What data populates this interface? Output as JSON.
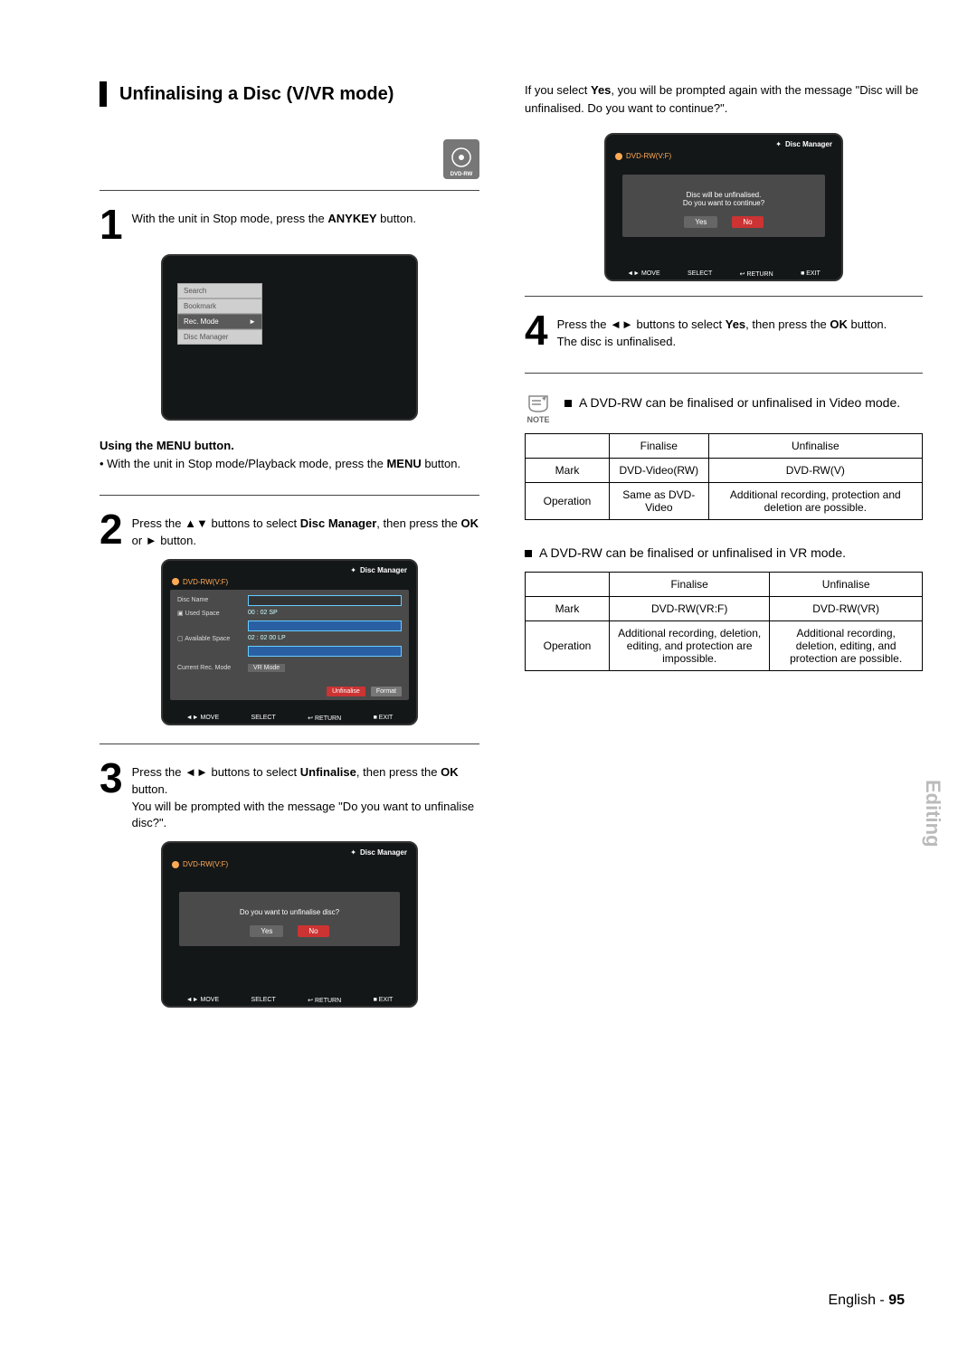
{
  "title": "Unfinalising a Disc (V/VR mode)",
  "disc_icon_label": "DVD-RW",
  "step1": {
    "num": "1",
    "text_a": "With the unit in Stop mode, press the ",
    "bold": "ANYKEY",
    "text_b": " button."
  },
  "anykey_menu": {
    "items": [
      "Search",
      "Bookmark",
      "Rec. Mode",
      "Disc Manager"
    ],
    "selected": "Rec. Mode",
    "arrow": "►"
  },
  "using_menu_head": "Using the MENU button.",
  "using_menu_text_a": "• With the unit in Stop mode/Playback mode, press the ",
  "using_menu_bold": "MENU",
  "using_menu_text_b": " button.",
  "step2": {
    "num": "2",
    "text_a": "Press the ▲▼ buttons to select ",
    "bold1": "Disc Manager",
    "text_b": ", then press the ",
    "bold2": "OK",
    "text_c": " or ► button."
  },
  "dm_screen": {
    "header": "Disc Manager",
    "sub": "DVD-RW(V:F)",
    "rows": {
      "disc_name": "Disc Name",
      "used_space": "Used Space",
      "used_val": "00 : 02  SP",
      "avail_space": "Available Space",
      "avail_val": "02 : 02  00 LP",
      "rec_mode_label": "Current Rec. Mode",
      "rec_mode_val": "VR Mode"
    },
    "btn_unfinalise": "Unfinalise",
    "btn_format": "Format",
    "foot": {
      "move": "◄► MOVE",
      "select": "SELECT",
      "return": "↩ RETURN",
      "exit": "■ EXIT"
    }
  },
  "step3": {
    "num": "3",
    "text_a": "Press the ◄► buttons to select ",
    "bold1": "Unfinalise",
    "text_b": ", then press the ",
    "bold2": "OK",
    "text_c": " button.",
    "line2": "You will be prompted with the message \"Do you want to unfinalise disc?\"."
  },
  "prompt1": {
    "msg": "Do you want to unfinalise disc?",
    "yes": "Yes",
    "no": "No"
  },
  "right_intro_a": "If you select ",
  "right_intro_bold": "Yes",
  "right_intro_b": ", you will be prompted again with the message \"Disc will be unfinalised. Do you want to continue?\".",
  "prompt2": {
    "line1": "Disc will be unfinalised.",
    "line2": "Do you want to continue?",
    "yes": "Yes",
    "no": "No"
  },
  "step4": {
    "num": "4",
    "text_a": "Press the ◄► buttons to select ",
    "bold1": "Yes",
    "text_b": ", then press the ",
    "bold2": "OK",
    "text_c": " button.",
    "line2": "The disc is unfinalised."
  },
  "note_label": "NOTE",
  "note1": "A DVD-RW can be finalised or unfinalised in Video mode.",
  "table1": {
    "h_finalise": "Finalise",
    "h_unfinalise": "Unfinalise",
    "r_mark": "Mark",
    "mark_fin": "DVD-Video(RW)",
    "mark_unfin": "DVD-RW(V)",
    "r_op": "Operation",
    "op_fin": "Same as DVD-Video",
    "op_unfin": "Additional recording, protection and deletion are possible."
  },
  "note2": "A DVD-RW can be finalised or unfinalised in VR mode.",
  "table2": {
    "h_finalise": "Finalise",
    "h_unfinalise": "Unfinalise",
    "r_mark": "Mark",
    "mark_fin": "DVD-RW(VR:F)",
    "mark_unfin": "DVD-RW(VR)",
    "r_op": "Operation",
    "op_fin": "Additional recording, deletion, editing, and protection are impossible.",
    "op_unfin": "Additional recording, deletion, editing, and protection are possible."
  },
  "side_label": "Editing",
  "footer_lang": "English",
  "footer_sep": " - ",
  "footer_page": "95"
}
